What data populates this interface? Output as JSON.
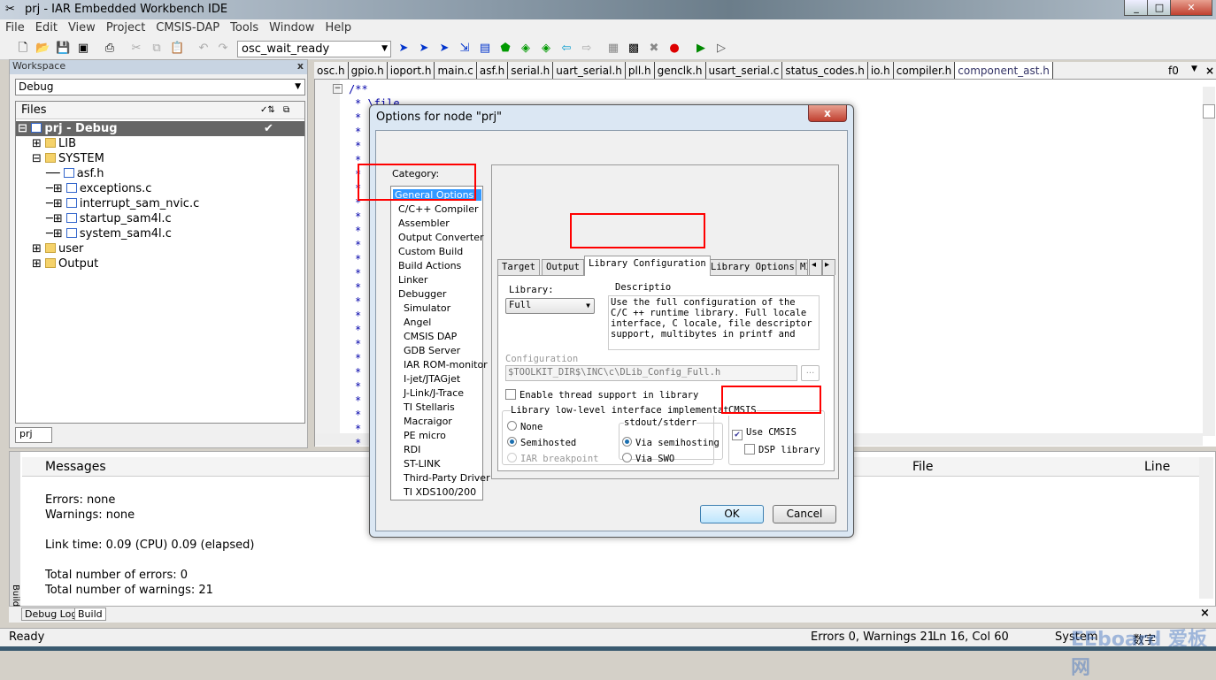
{
  "window": {
    "title": "prj - IAR Embedded Workbench IDE",
    "controls": [
      "_",
      "□",
      "✕"
    ]
  },
  "menu": [
    "File",
    "Edit",
    "View",
    "Project",
    "CMSIS-DAP",
    "Tools",
    "Window",
    "Help"
  ],
  "toolbar": {
    "search_combo": "osc_wait_ready"
  },
  "workspace": {
    "title": "Workspace",
    "close": "x",
    "config": "Debug",
    "files_header": "Files",
    "tab": "prj",
    "tree": [
      {
        "label": "prj - Debug",
        "level": 0,
        "type": "project",
        "selected": true
      },
      {
        "label": "LIB",
        "level": 1,
        "type": "folder"
      },
      {
        "label": "SYSTEM",
        "level": 1,
        "type": "folder"
      },
      {
        "label": "asf.h",
        "level": 2,
        "type": "file"
      },
      {
        "label": "exceptions.c",
        "level": 2,
        "type": "file"
      },
      {
        "label": "interrupt_sam_nvic.c",
        "level": 2,
        "type": "file"
      },
      {
        "label": "startup_sam4l.c",
        "level": 2,
        "type": "file"
      },
      {
        "label": "system_sam4l.c",
        "level": 2,
        "type": "file"
      },
      {
        "label": "user",
        "level": 1,
        "type": "folder"
      },
      {
        "label": "Output",
        "level": 1,
        "type": "folder"
      }
    ]
  },
  "editor": {
    "tabs": [
      "osc.h",
      "gpio.h",
      "ioport.h",
      "main.c",
      "asf.h",
      "serial.h",
      "uart_serial.h",
      "pll.h",
      "genclk.h",
      "usart_serial.c",
      "status_codes.h",
      "io.h",
      "compiler.h",
      "component_ast.h"
    ],
    "active_tab": "component_ast.h",
    "func_indicator": "f0",
    "first_line": "/**",
    "second_line": "* \\file"
  },
  "messages": {
    "header": "Messages",
    "file_col": "File",
    "line_col": "Line",
    "lines": [
      "Errors: none",
      "Warnings: none",
      "",
      "Link time:  0.09 (CPU)   0.09 (elapsed)",
      "",
      "Total number of errors: 0",
      "Total number of warnings: 21"
    ],
    "side_label": "Build",
    "tabs": [
      "Debug Log",
      "Build"
    ],
    "close": "×"
  },
  "status": {
    "ready": "Ready",
    "errors": "Errors 0, Warnings 21",
    "position": "Ln 16, Col 60",
    "ime": "System",
    "ime2": "数字",
    "watermark": "EEboard 爱板网"
  },
  "dialog": {
    "title": "Options for node \"prj\"",
    "close": "x",
    "category_label": "Category:",
    "categories": [
      "General Options",
      "C/C++ Compiler",
      "Assembler",
      "Output Converter",
      "Custom Build",
      "Build Actions",
      "Linker",
      "Debugger",
      "Simulator",
      "Angel",
      "CMSIS DAP",
      "GDB Server",
      "IAR ROM-monitor",
      "I-jet/JTAGjet",
      "J-Link/J-Trace",
      "TI Stellaris",
      "Macraigor",
      "PE micro",
      "RDI",
      "ST-LINK",
      "Third-Party Driver",
      "TI XDS100/200"
    ],
    "selected_category": "General Options",
    "tabs": [
      "Target",
      "Output",
      "Library Configuration",
      "Library Options",
      "MI"
    ],
    "active_tab": "Library Configuration",
    "library_label": "Library:",
    "library_value": "Full",
    "description_label": "Descriptio",
    "description": "Use the full configuration of the C/C ++ runtime library. Full locale interface, C locale, file descriptor support, multibytes in printf and",
    "configuration_label": "Configuration",
    "configuration_value": "$TOOLKIT_DIR$\\INC\\c\\DLib_Config_Full.h",
    "browse": "...",
    "thread_support": "Enable thread support in library",
    "lowlevel_label": "Library low-level interface implementatic",
    "lowlevel": [
      {
        "label": "None",
        "checked": false
      },
      {
        "label": "Semihosted",
        "checked": true
      },
      {
        "label": "IAR breakpoint",
        "checked": false,
        "disabled": true
      }
    ],
    "stdout_label": "stdout/stderr",
    "stdout": [
      {
        "label": "Via semihosting",
        "checked": true
      },
      {
        "label": "Via SWO",
        "checked": false
      }
    ],
    "cmsis_label": "CMSIS",
    "use_cmsis": "Use CMSIS",
    "use_cmsis_checked": true,
    "dsp": "DSP library",
    "dsp_checked": false,
    "ok": "OK",
    "cancel": "Cancel"
  },
  "colors": {
    "highlight": "#3399ff",
    "annotation": "#ff0000"
  }
}
